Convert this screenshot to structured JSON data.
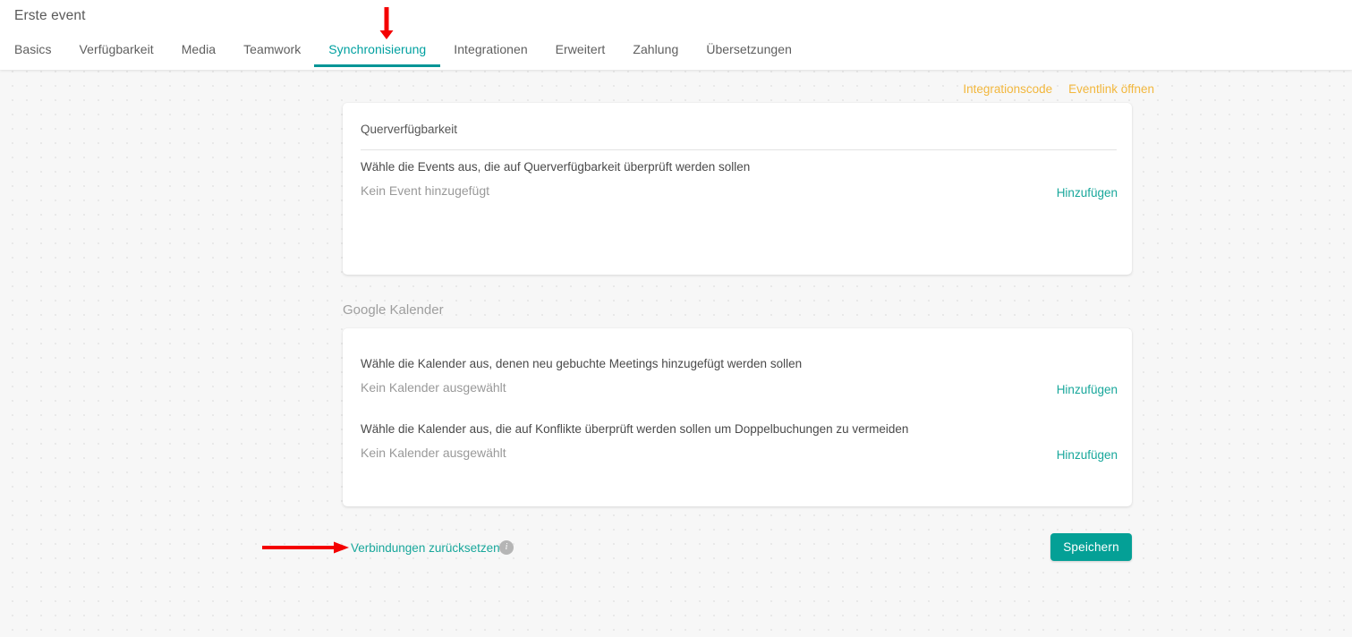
{
  "header": {
    "title": "Erste event",
    "tabs": [
      {
        "label": "Basics",
        "active": false
      },
      {
        "label": "Verfügbarkeit",
        "active": false
      },
      {
        "label": "Media",
        "active": false
      },
      {
        "label": "Teamwork",
        "active": false
      },
      {
        "label": "Synchronisierung",
        "active": true
      },
      {
        "label": "Integrationen",
        "active": false
      },
      {
        "label": "Erweitert",
        "active": false
      },
      {
        "label": "Zahlung",
        "active": false
      },
      {
        "label": "Übersetzungen",
        "active": false
      }
    ]
  },
  "toplinks": [
    {
      "label": "Integrationscode"
    },
    {
      "label": "Eventlink öffnen"
    }
  ],
  "cross_availability": {
    "card_title": "Querverfügbarkeit",
    "field_label": "Wähle die Events aus, die auf Querverfügbarkeit überprüft werden sollen",
    "field_value": "Kein Event hinzugefügt",
    "add_label": "Hinzufügen"
  },
  "google_calendar": {
    "section_heading": "Google Kalender",
    "row1": {
      "field_label": "Wähle die Kalender aus, denen neu gebuchte Meetings hinzugefügt werden sollen",
      "field_value": "Kein Kalender ausgewählt",
      "add_label": "Hinzufügen"
    },
    "row2": {
      "field_label": "Wähle die Kalender aus, die auf Konflikte überprüft werden sollen um Doppelbuchungen zu vermeiden",
      "field_value": "Kein Kalender ausgewählt",
      "add_label": "Hinzufügen"
    }
  },
  "footer": {
    "reset_label": "Verbindungen zurücksetzen",
    "info_icon_glyph": "i",
    "save_label": "Speichern"
  },
  "annotations": {
    "arrow_down_name": "red-arrow-down-annotation",
    "arrow_right_name": "red-arrow-right-annotation",
    "arrow_color": "#f40000"
  },
  "colors": {
    "accent_teal": "#04a096",
    "link_teal": "#18a79b",
    "toplink_amber": "#f2b73d",
    "page_background": "#f7f7f7",
    "card_background": "#ffffff"
  }
}
